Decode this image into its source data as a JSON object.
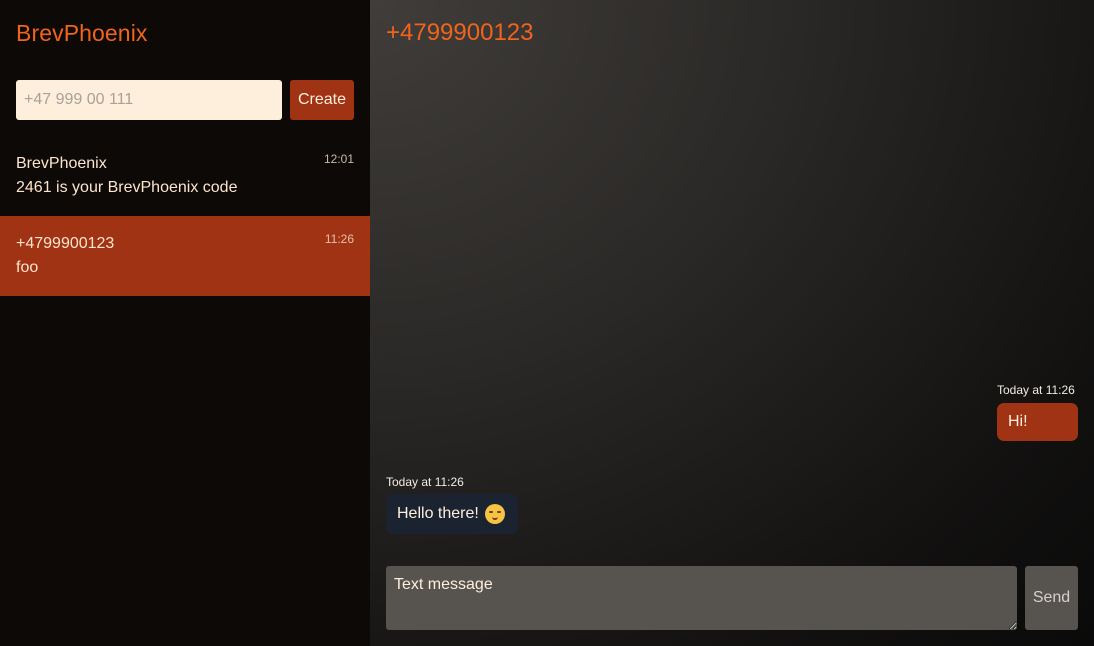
{
  "app": {
    "title": "BrevPhoenix"
  },
  "new_conversation": {
    "placeholder": "+47 999 00 111",
    "create_label": "Create"
  },
  "conversations": [
    {
      "name": "BrevPhoenix",
      "preview": "2461 is your BrevPhoenix code",
      "time": "12:01",
      "active": false
    },
    {
      "name": "+4799900123",
      "preview": "foo",
      "time": "11:26",
      "active": true
    }
  ],
  "chat": {
    "title": "+4799900123",
    "messages": [
      {
        "direction": "outgoing",
        "time": "Today at 11:26",
        "text": "Hi!"
      },
      {
        "direction": "incoming",
        "time": "Today at 11:26",
        "text": "Hello there!",
        "emoji": "face-with-hand-over-mouth-icon"
      }
    ],
    "compose_placeholder": "Text message",
    "send_label": "Send"
  },
  "colors": {
    "accent": "#f0641e",
    "active_item": "#9f3314",
    "outgoing_bubble": "#9f3314",
    "incoming_bubble": "#1b2230",
    "input_bg": "#fdefdb",
    "compose_bg": "#57534e"
  }
}
